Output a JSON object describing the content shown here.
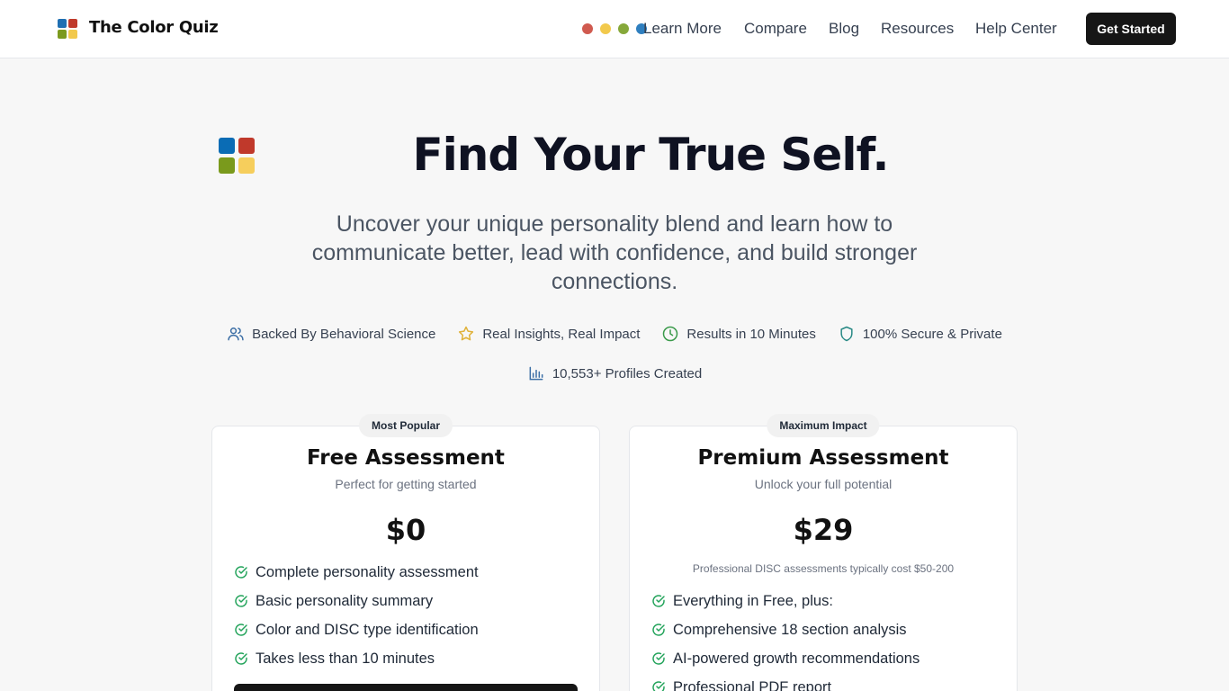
{
  "header": {
    "brand": "The Color Quiz",
    "logo_colors": [
      "#1f6fb2",
      "#c03a2b",
      "#7c9a1e",
      "#f2c94c"
    ],
    "dot_colors": [
      "#d05a4f",
      "#f2c94c",
      "#86a83a",
      "#2f7fbf"
    ],
    "nav": [
      "Learn More",
      "Compare",
      "Blog",
      "Resources",
      "Help Center"
    ],
    "cta_label": "Get Started"
  },
  "hero": {
    "logo_colors": [
      "#0a6cb5",
      "#c0392b",
      "#7a9a1c",
      "#f6ce5c"
    ],
    "title": "Find Your True Self.",
    "subtitle": "Uncover your unique personality blend and learn how to communicate better, lead with confidence, and build stronger connections.",
    "features": [
      {
        "icon": "users-icon",
        "label": "Backed By Behavioral Science",
        "color": "#3b6ea5"
      },
      {
        "icon": "star-icon",
        "label": "Real Insights, Real Impact",
        "color": "#e0b23a"
      },
      {
        "icon": "clock-icon",
        "label": "Results in 10 Minutes",
        "color": "#3a9a4a"
      },
      {
        "icon": "shield-icon",
        "label": "100% Secure & Private",
        "color": "#2a8a86"
      }
    ],
    "stat": {
      "icon": "bar-chart-icon",
      "label": "10,553+ Profiles Created",
      "color": "#3b6ea5"
    }
  },
  "plans": [
    {
      "badge": "Most Popular",
      "title": "Free Assessment",
      "subtitle": "Perfect for getting started",
      "price": "$0",
      "note": "",
      "features": [
        "Complete personality assessment",
        "Basic personality summary",
        "Color and DISC type identification",
        "Takes less than 10 minutes"
      ]
    },
    {
      "badge": "Maximum Impact",
      "title": "Premium Assessment",
      "subtitle": "Unlock your full potential",
      "price": "$29",
      "note": "Professional DISC assessments typically cost $50-200",
      "features": [
        "Everything in Free, plus:",
        "Comprehensive 18 section analysis",
        "AI-powered growth recommendations",
        "Professional PDF report"
      ]
    }
  ],
  "check_color": "#22a35a"
}
